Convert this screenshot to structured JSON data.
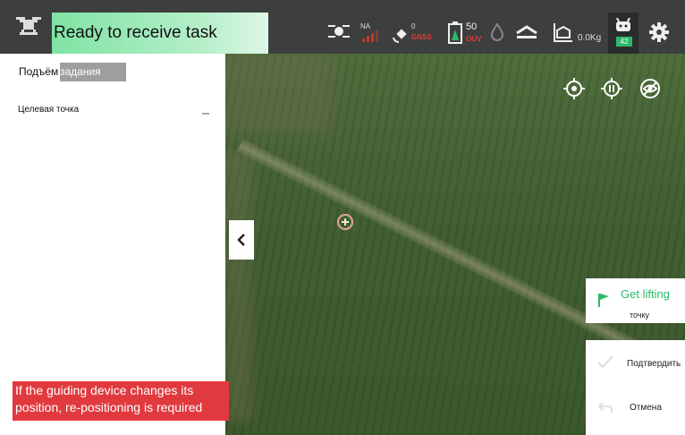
{
  "status": {
    "text": "Ready to receive task"
  },
  "topbar": {
    "rtk_na": "NA",
    "gnss_count": "0",
    "gnss_label": "GNSS",
    "battery_value": "50",
    "battery_unit": "OUV",
    "weight": "0.0Kg",
    "rc_value": "42"
  },
  "left_panel": {
    "takeoff_label": "Подъём",
    "takeoff_value": "задания",
    "target_label": "Целевая точка"
  },
  "warning": {
    "text": "If the guiding device changes its position, re-positioning is required"
  },
  "right_panel": {
    "get_lift_title": "Get lifting",
    "get_lift_sub": "точку",
    "confirm_label": "Подтвердить",
    "cancel_label": "Отмена"
  },
  "colors": {
    "accent_green": "#2db96a",
    "warning_red": "#e03a3f",
    "topbar_bg": "#3c3f3e"
  }
}
